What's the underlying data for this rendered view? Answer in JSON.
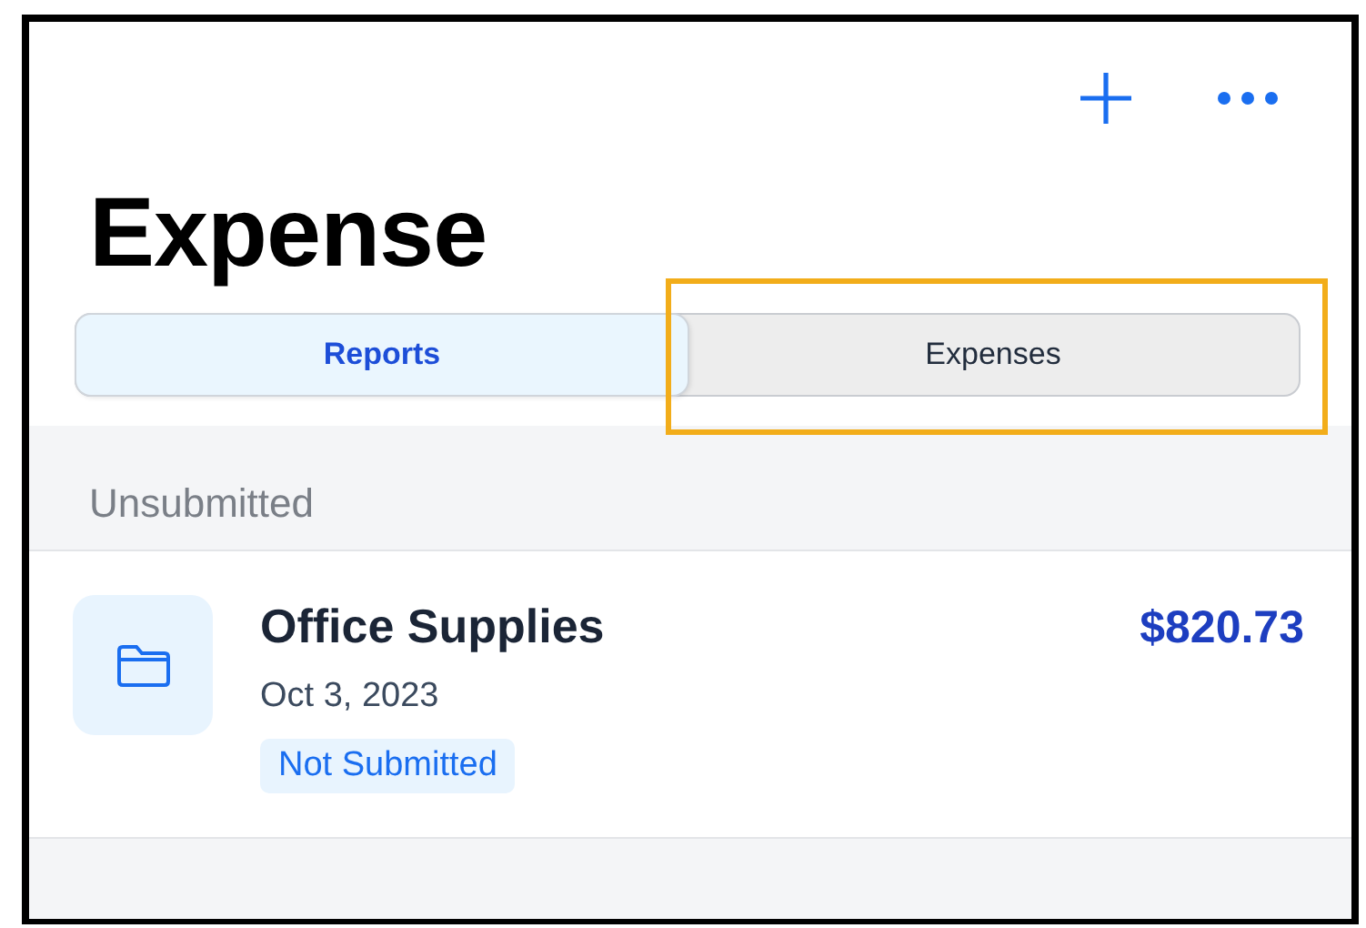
{
  "header": {
    "actions": [
      {
        "kind": "add"
      },
      {
        "kind": "more"
      }
    ],
    "title": "Expense"
  },
  "tabs": [
    {
      "label": "Reports",
      "selected": true,
      "highlighted": false
    },
    {
      "label": "Expenses",
      "selected": false,
      "highlighted": true
    }
  ],
  "sections": [
    {
      "title": "Unsubmitted",
      "items": [
        {
          "name": "Office Supplies",
          "date": "Oct 3, 2023",
          "amount": "$820.73",
          "status": "Not Submitted"
        }
      ]
    }
  ]
}
